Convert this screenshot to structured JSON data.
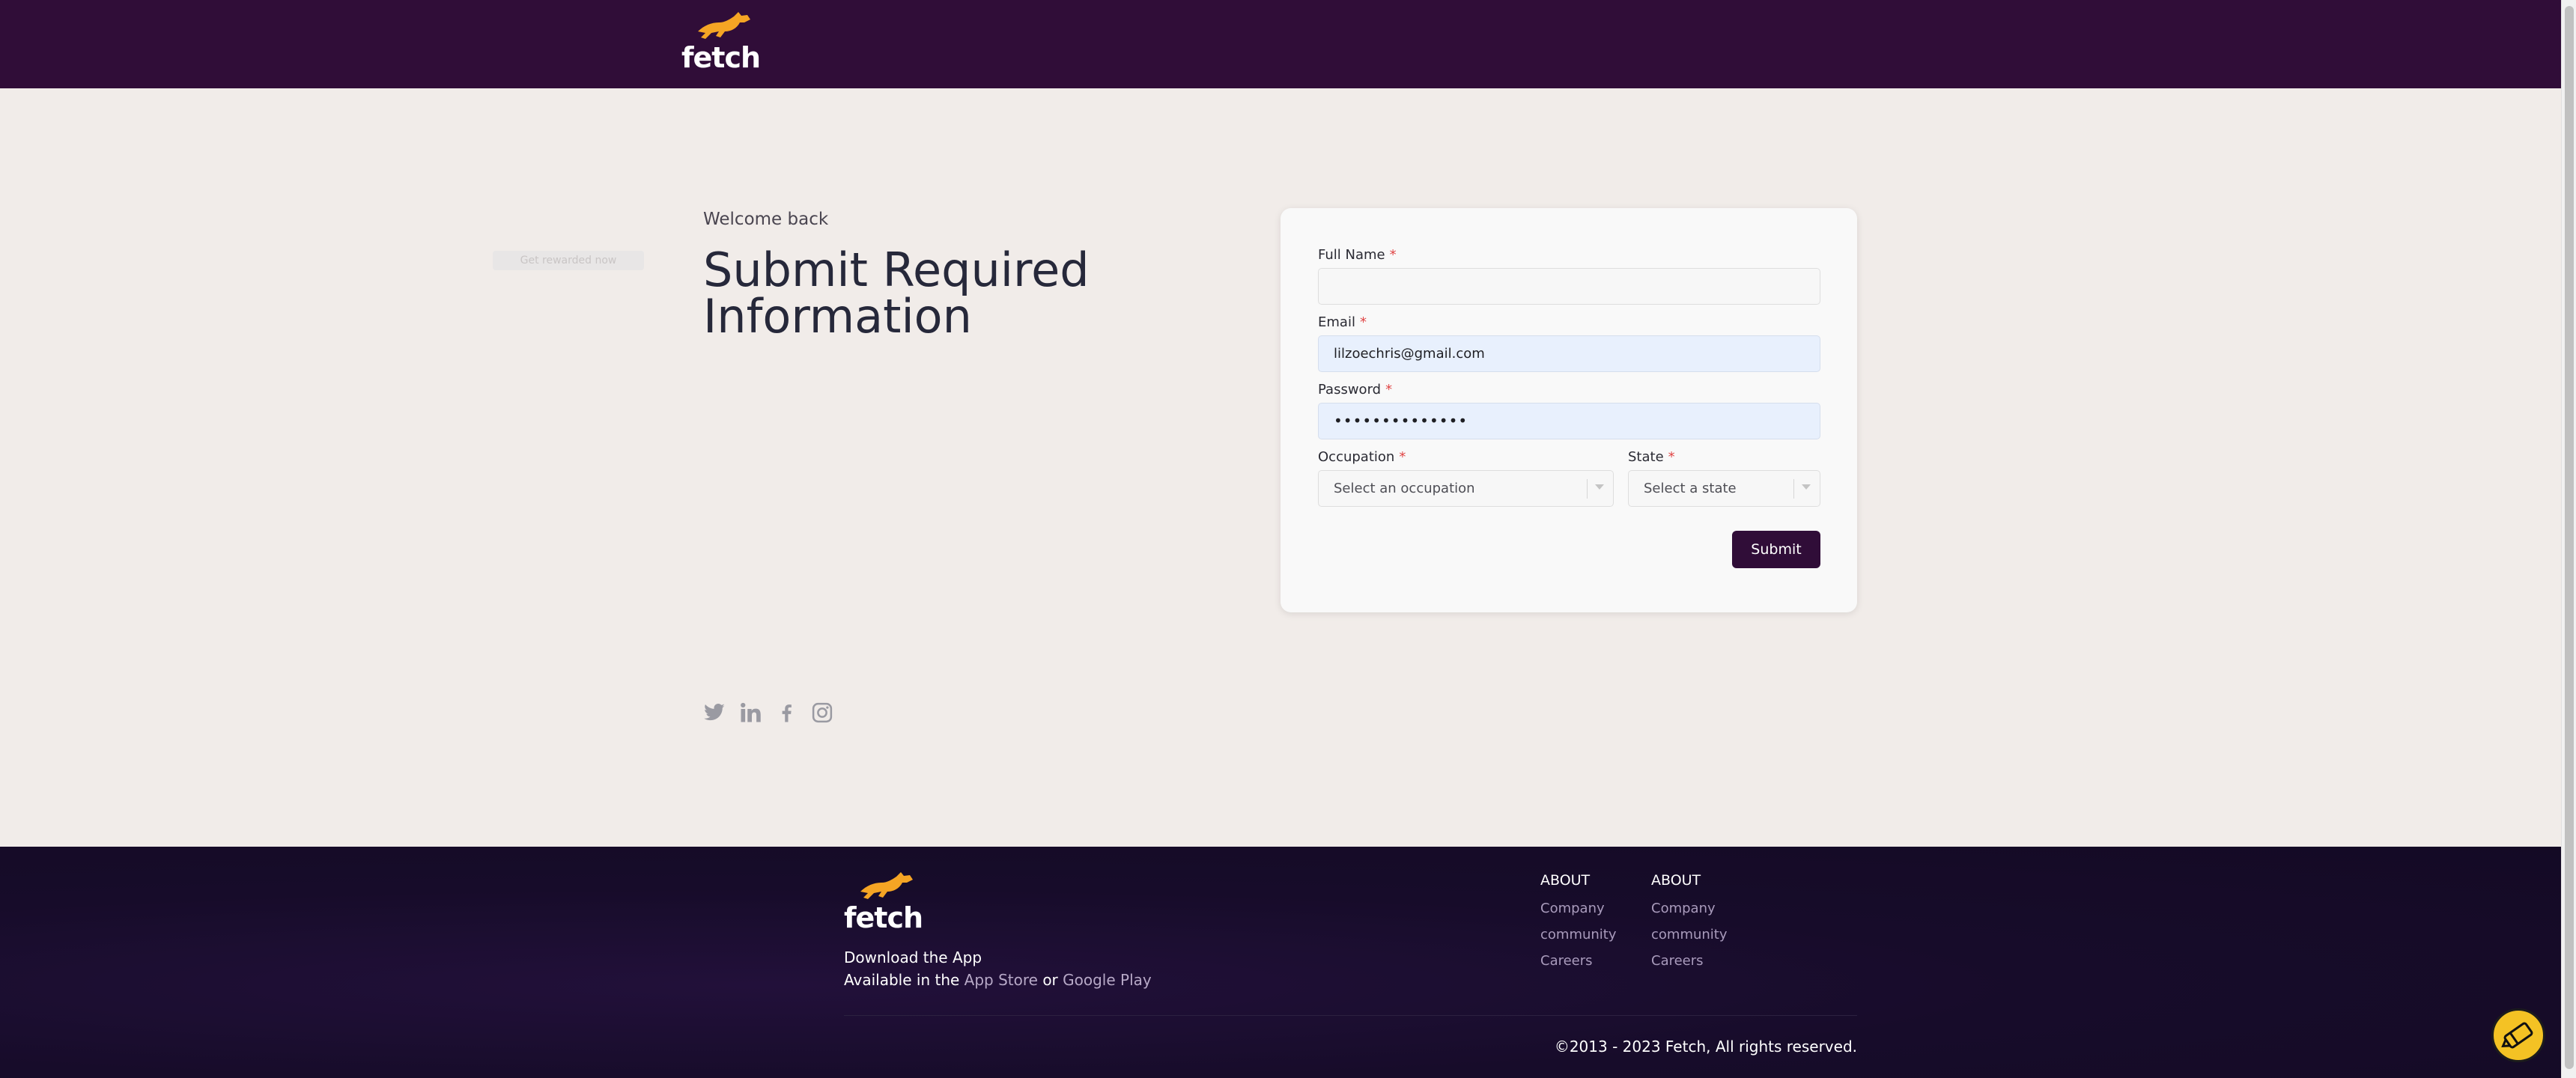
{
  "header": {
    "logo_text": "fetch"
  },
  "ghost": {
    "text": "Get rewarded now"
  },
  "intro": {
    "welcome": "Welcome back",
    "title": "Submit Required Information"
  },
  "form": {
    "full_name_label": "Full Name",
    "full_name_value": "",
    "email_label": "Email",
    "email_value": "lilzoechris@gmail.com",
    "password_label": "Password",
    "password_value": "••••••••••••••",
    "occupation_label": "Occupation",
    "occupation_placeholder": "Select an occupation",
    "state_label": "State",
    "state_placeholder": "Select a state",
    "required_mark": "*",
    "submit_label": "Submit"
  },
  "social": [
    "twitter-icon",
    "linkedin-icon",
    "facebook-icon",
    "instagram-icon"
  ],
  "footer": {
    "logo_text": "fetch",
    "download": "Download the App",
    "available_prefix": "Available in the",
    "app_store": "App Store",
    "or": "or",
    "google_play": "Google Play",
    "columns": [
      {
        "heading": "ABOUT",
        "links": [
          "Company",
          "community",
          "Careers"
        ]
      },
      {
        "heading": "ABOUT",
        "links": [
          "Company",
          "community",
          "Careers"
        ]
      }
    ],
    "copyright": "©2013 - 2023 Fetch, All rights reserved."
  },
  "colors": {
    "brand": "#300d38",
    "accent": "#f5a524",
    "page_bg": "#f1ece9"
  }
}
